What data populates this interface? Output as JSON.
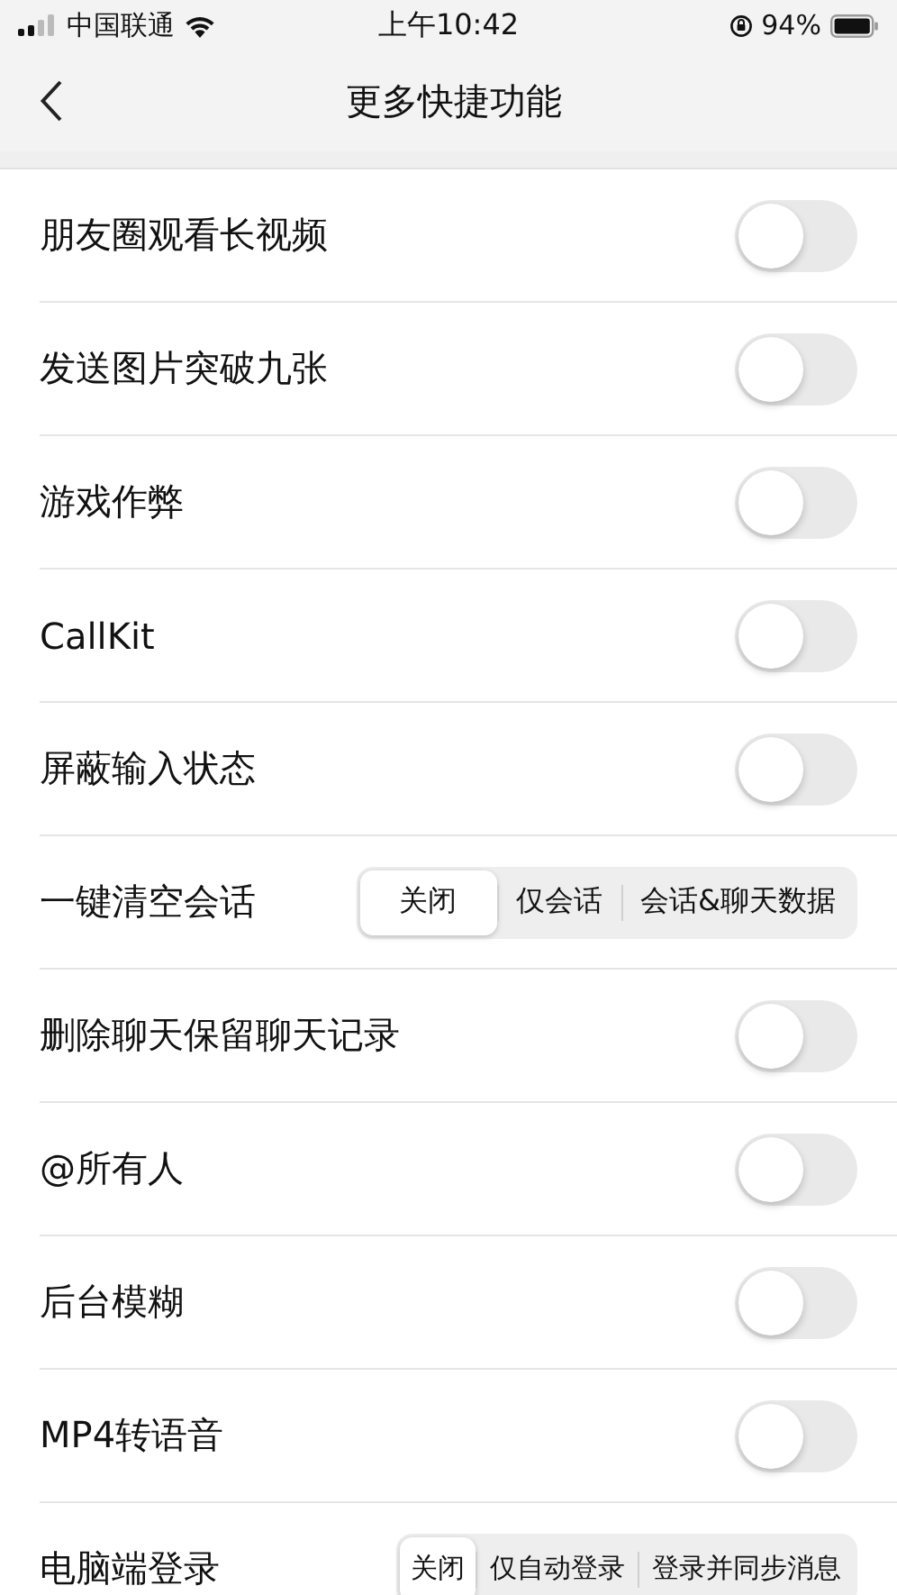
{
  "status_bar": {
    "carrier": "中国联通",
    "time": "上午10:42",
    "battery": "94%"
  },
  "nav": {
    "title": "更多快捷功能"
  },
  "rows": [
    {
      "kind": "toggle",
      "label": "朋友圈观看长视频",
      "on": false
    },
    {
      "kind": "toggle",
      "label": "发送图片突破九张",
      "on": false
    },
    {
      "kind": "toggle",
      "label": "游戏作弊",
      "on": false
    },
    {
      "kind": "toggle",
      "label": "CallKit",
      "on": false
    },
    {
      "kind": "toggle",
      "label": "屏蔽输入状态",
      "on": false
    },
    {
      "kind": "segmented",
      "label": "一键清空会话",
      "options": [
        {
          "label": "关闭",
          "selected": true
        },
        {
          "label": "仅会话",
          "selected": false
        },
        {
          "label": "会话&聊天数据",
          "selected": false
        }
      ]
    },
    {
      "kind": "toggle",
      "label": "删除聊天保留聊天记录",
      "on": false
    },
    {
      "kind": "toggle",
      "label": "@所有人",
      "on": false
    },
    {
      "kind": "toggle",
      "label": "后台模糊",
      "on": false
    },
    {
      "kind": "toggle",
      "label": "MP4转语音",
      "on": false
    },
    {
      "kind": "segmented",
      "label": "电脑端登录",
      "options": [
        {
          "label": "关闭",
          "selected": true
        },
        {
          "label": "仅自动登录",
          "selected": false
        },
        {
          "label": "登录并同步消息",
          "selected": false
        }
      ]
    }
  ]
}
